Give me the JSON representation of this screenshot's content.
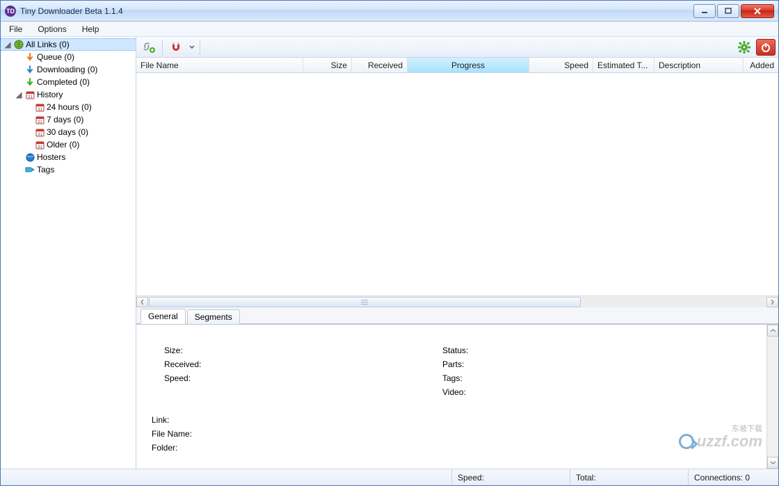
{
  "window": {
    "title": "Tiny Downloader Beta 1.1.4",
    "icon_text": "TD"
  },
  "menu": {
    "file": "File",
    "options": "Options",
    "help": "Help"
  },
  "tree": {
    "all_links": "All Links (0)",
    "queue": "Queue (0)",
    "downloading": "Downloading (0)",
    "completed": "Completed (0)",
    "history": "History",
    "h24": "24 hours (0)",
    "h7": "7 days (0)",
    "h30": "30 days (0)",
    "older": "Older (0)",
    "hosters": "Hosters",
    "tags": "Tags"
  },
  "toolbar": {
    "add_link_icon": "link-add-icon",
    "magnet_icon": "magnet-icon",
    "settings_icon": "gear-icon",
    "power_icon": "power-icon"
  },
  "columns": {
    "filename": "File Name",
    "size": "Size",
    "received": "Received",
    "progress": "Progress",
    "speed": "Speed",
    "estimated": "Estimated T...",
    "description": "Description",
    "added": "Added"
  },
  "tabs": {
    "general": "General",
    "segments": "Segments"
  },
  "details": {
    "size": "Size:",
    "received": "Received:",
    "speed": "Speed:",
    "status": "Status:",
    "parts": "Parts:",
    "tags": "Tags:",
    "video": "Video:",
    "link": "Link:",
    "filename": "File Name:",
    "folder": "Folder:"
  },
  "status": {
    "speed": "Speed:",
    "total": "Total:",
    "connections": "Connections: 0"
  },
  "watermark": {
    "text": "uzzf.com",
    "cn": "东坡下载"
  }
}
